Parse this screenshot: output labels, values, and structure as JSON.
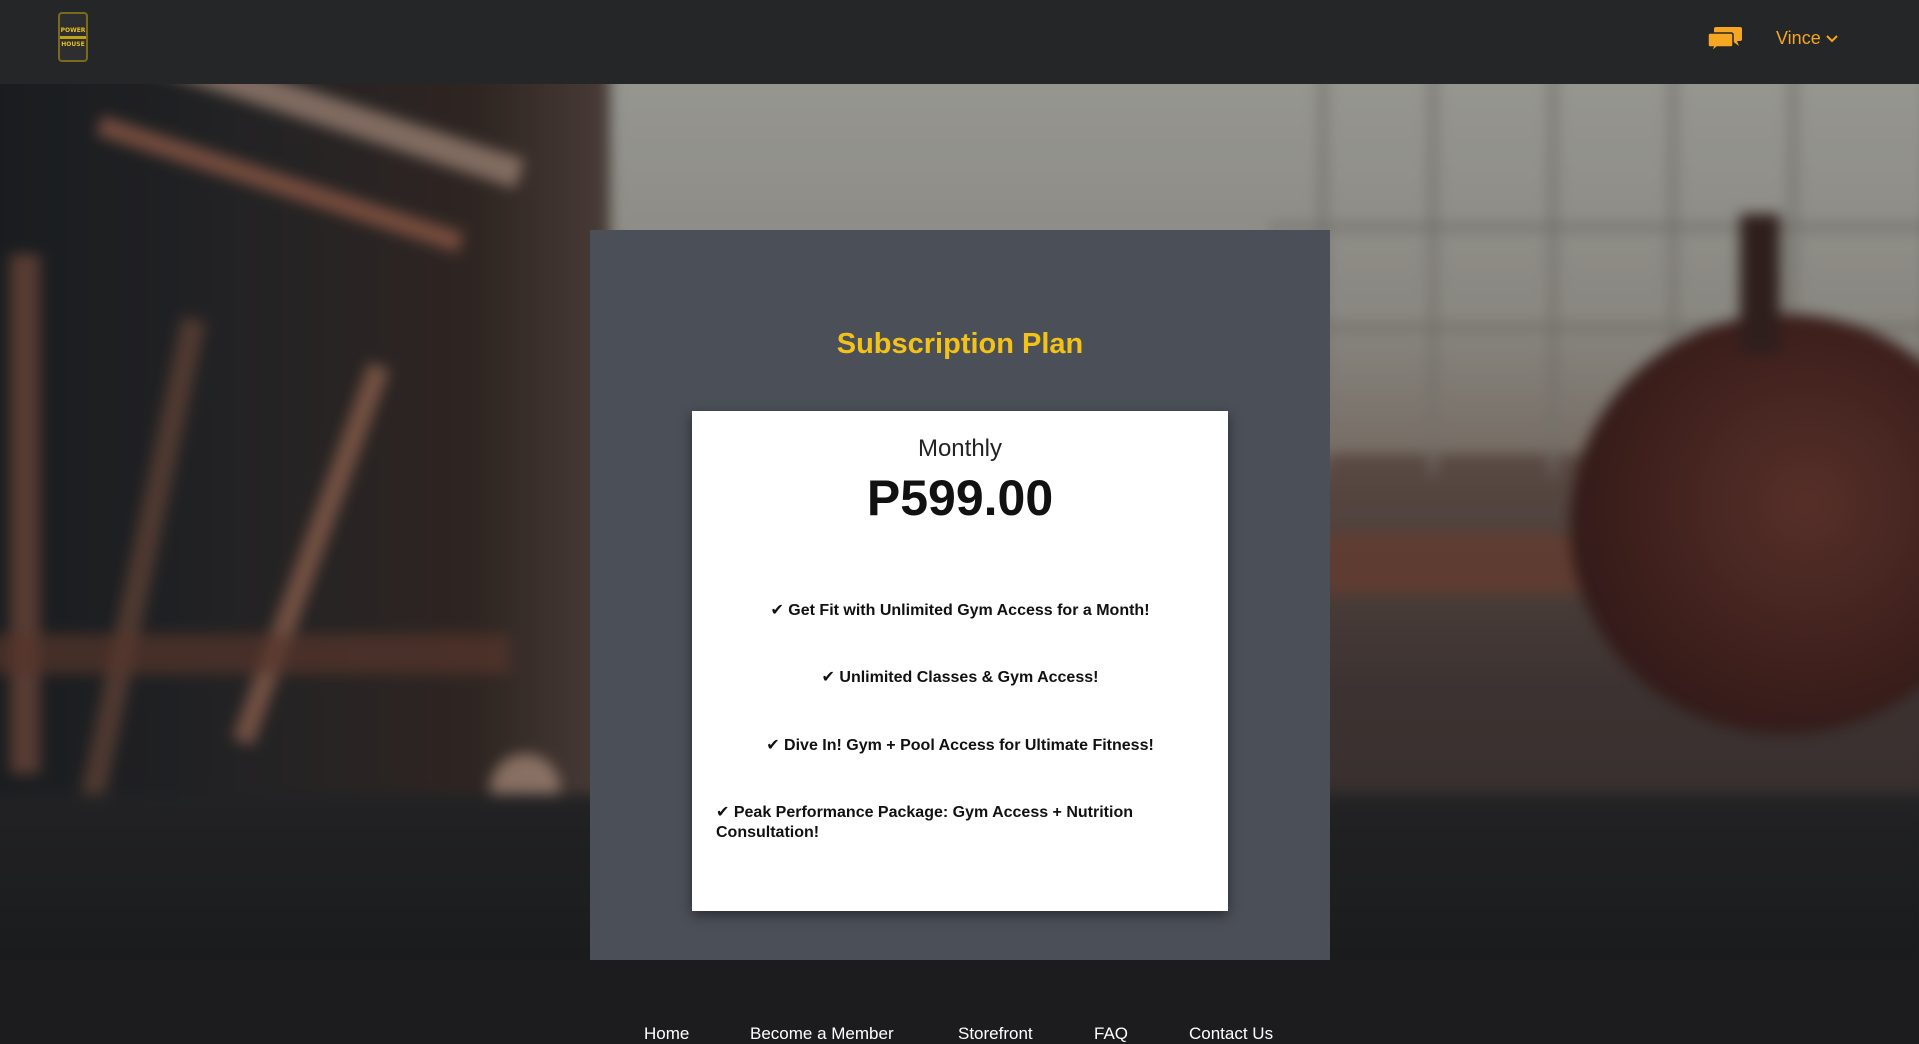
{
  "header": {
    "logo_lines": [
      "POWER",
      "HOUSE"
    ],
    "user_name": "Vince"
  },
  "main": {
    "panel_title": "Subscription Plan",
    "plan": {
      "name": "Monthly",
      "price": "P599.00",
      "features": [
        "✔ Get Fit with Unlimited Gym Access for a Month!",
        "✔ Unlimited Classes & Gym Access!",
        "✔ Dive In! Gym + Pool Access for Ultimate Fitness!",
        "✔ Peak Performance Package: Gym Access + Nutrition Consultation!"
      ]
    }
  },
  "footer": {
    "links": [
      "Home",
      "Become a Member",
      "Storefront",
      "FAQ",
      "Contact Us"
    ]
  },
  "colors": {
    "accent": "#f3c218",
    "user_accent": "#f5a623",
    "topbar": "#252628",
    "panel": "#4b4f57"
  },
  "icons": [
    "logo-icon",
    "chat-icon",
    "chevron-down-icon"
  ]
}
